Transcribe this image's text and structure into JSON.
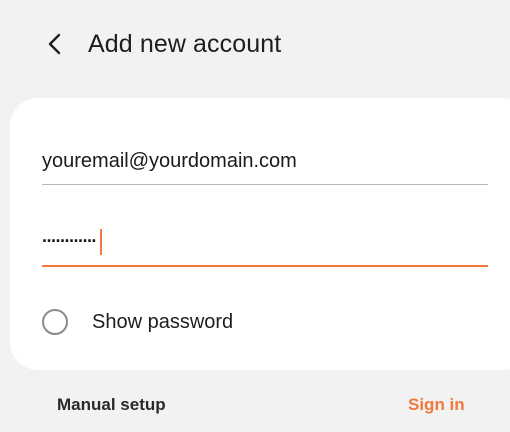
{
  "header": {
    "back_icon": "chevron-left-icon",
    "title": "Add new account"
  },
  "form": {
    "email_value": "youremail@yourdomain.com",
    "password_value": "············",
    "password_focused": true,
    "show_password_label": "Show password",
    "show_password_checked": false
  },
  "footer": {
    "manual_setup_label": "Manual setup",
    "sign_in_label": "Sign in"
  },
  "colors": {
    "accent": "#f07a3e",
    "background": "#f2f2f2",
    "card": "#ffffff",
    "divider": "#b8b8b8"
  }
}
